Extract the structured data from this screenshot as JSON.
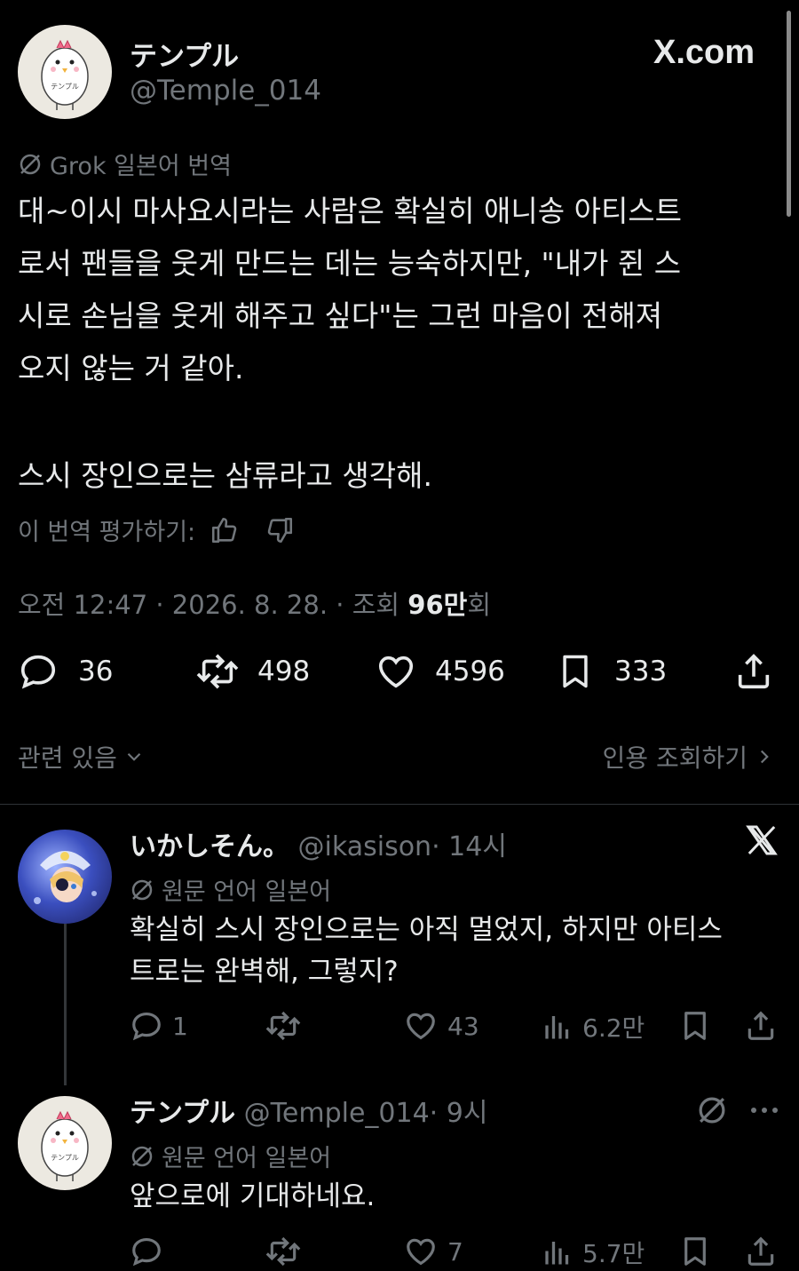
{
  "site": "X.com",
  "main_post": {
    "display_name": "テンプル",
    "handle": "@Temple_014",
    "translation_label": "Grok 일본어 번역",
    "body_lines": [
      "대~이시 마사요시라는 사람은 확실히 애니송 아티스트",
      "로서 팬들을 웃게 만드는 데는 능숙하지만, \"내가 쥔 스",
      "시로 손님을 웃게 해주고 싶다\"는 그런 마음이 전해져",
      "오지 않는 거 같아."
    ],
    "body_last": "스시 장인으로는 삼류라고 생각해.",
    "rate_label": "이 번역 평가하기:",
    "meta_time": "오전 12:47 · 2026. 8. 28. · 조회",
    "meta_views_number": "96만",
    "meta_views_suffix": "회",
    "stats": {
      "replies": "36",
      "reposts": "498",
      "likes": "4596",
      "bookmarks": "333"
    },
    "related_label": "관련 있음",
    "quotes_label": "인용 조회하기"
  },
  "replies": [
    {
      "display_name": "いかしそん。",
      "handle": "@ikasison",
      "time": "· 14시",
      "translation_label": "원문 언어 일본어",
      "body_lines": [
        "확실히 스시 장인으로는 아직 멀었지, 하지만 아티스",
        "트로는 완벽해, 그렇지?"
      ],
      "stats": {
        "replies": "1",
        "likes": "43",
        "views": "6.2만"
      }
    },
    {
      "display_name": "テンプル",
      "handle": "@Temple_014",
      "time": "· 9시",
      "translation_label": "원문 언어 일본어",
      "body_lines": [
        "앞으로에 기대하네요."
      ],
      "stats": {
        "likes": "7",
        "views": "5.7만"
      }
    }
  ],
  "avatar_text": "テンプル",
  "icons": [
    "grok-icon",
    "thumbs-up-icon",
    "thumbs-down-icon",
    "reply-icon",
    "repost-icon",
    "like-icon",
    "bookmark-icon",
    "share-icon",
    "views-icon",
    "more-icon",
    "chevron-down-icon",
    "chevron-right-icon",
    "x-logo-icon"
  ],
  "colors": {
    "background": "#000000",
    "text": "#e7e9ea",
    "muted": "#71767b",
    "divider": "#2f3336"
  }
}
